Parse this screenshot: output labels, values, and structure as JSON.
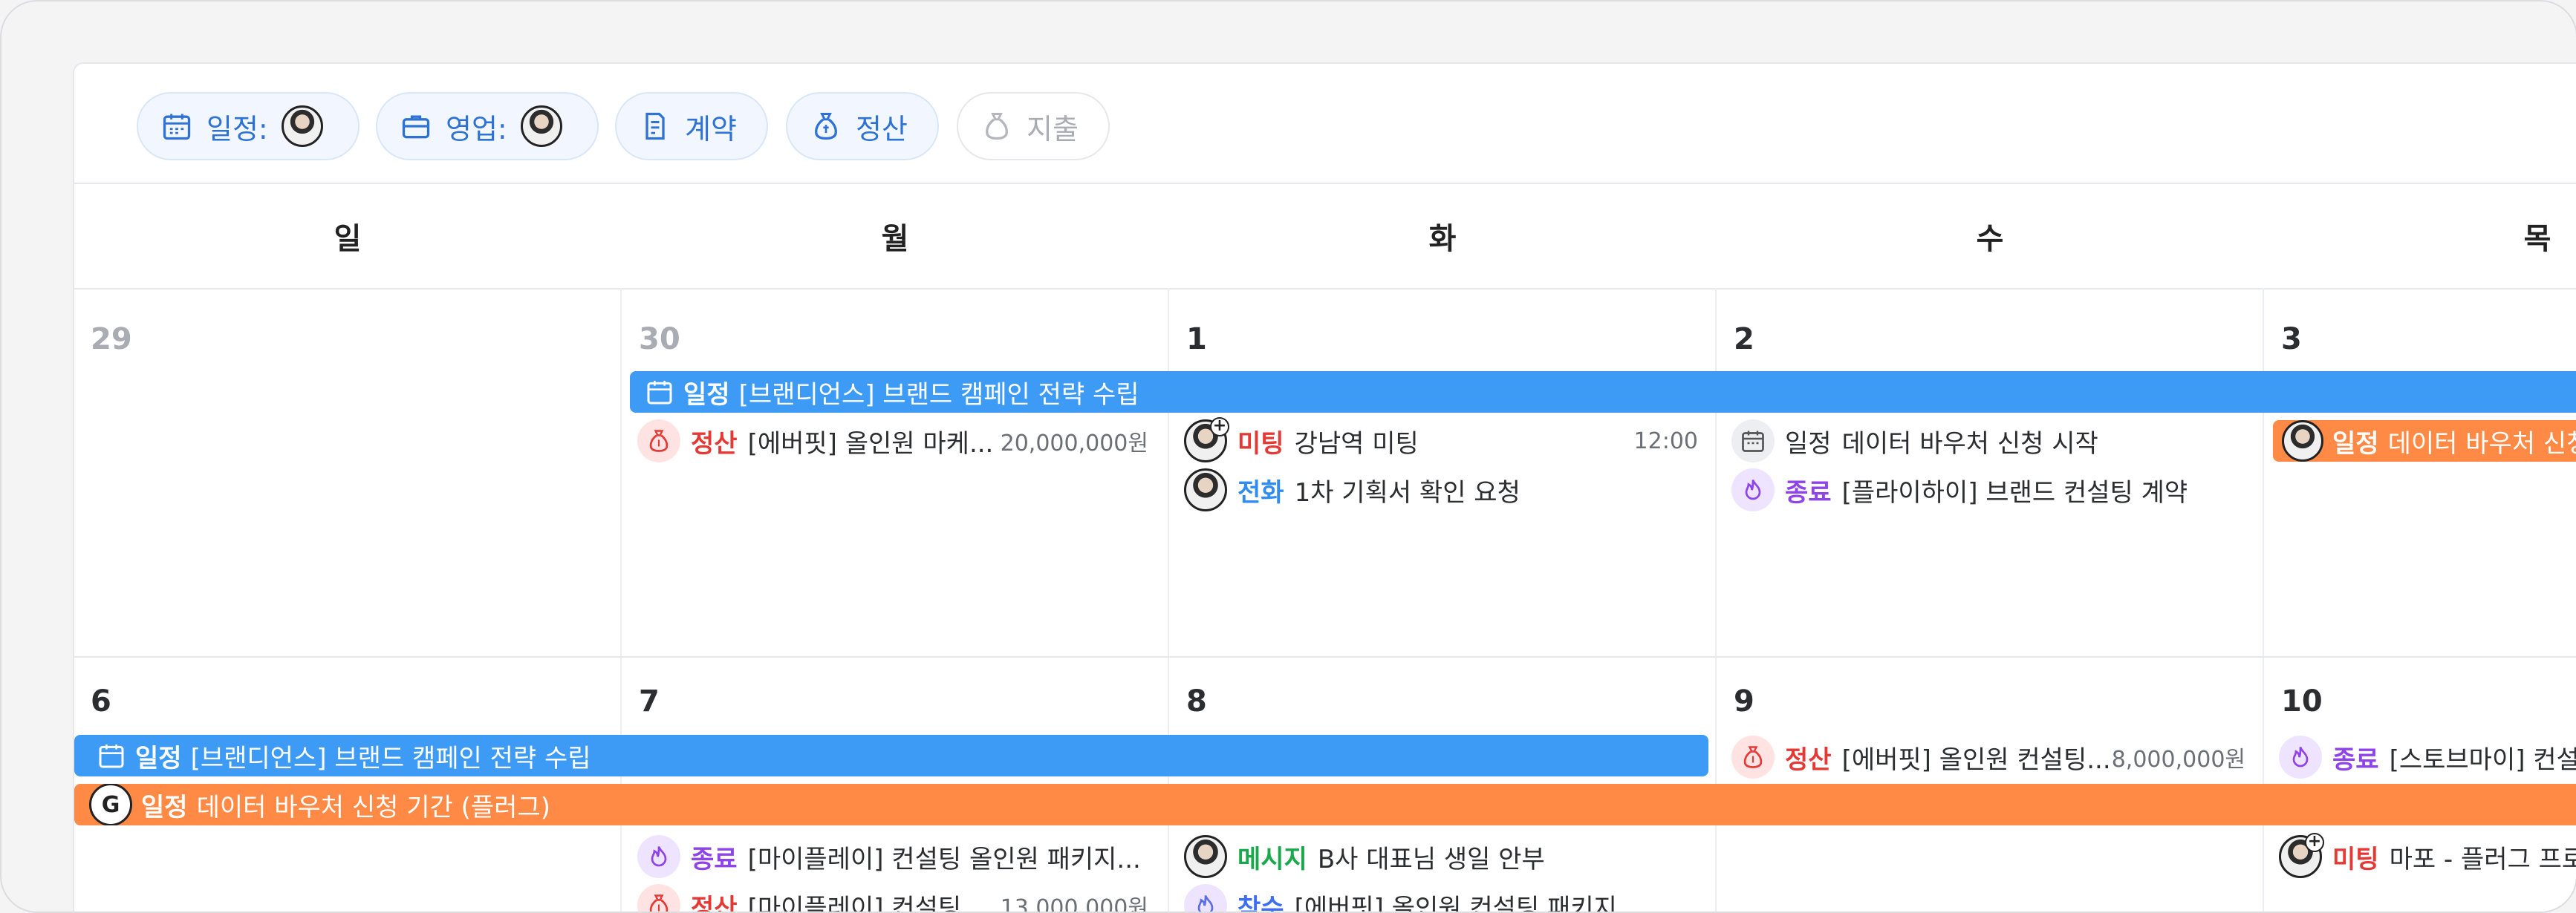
{
  "filters": {
    "schedule_label": "일정:",
    "sales_label": "영업:",
    "contract_label": "계약",
    "settlement_label": "정산",
    "expense_label": "지출"
  },
  "weekdays": [
    "일",
    "월",
    "화",
    "수",
    "목"
  ],
  "week1": {
    "dates": [
      "29",
      "30",
      "1",
      "2",
      "3"
    ],
    "span_bar": {
      "tag": "일정",
      "title": "[브랜디언스] 브랜드 캠페인 전략 수립"
    },
    "mon": [
      {
        "tag": "정산",
        "title": "[에버핏] 올인원 마케...",
        "amount": "20,000,000원"
      }
    ],
    "tue": [
      {
        "tag": "미팅",
        "title": "강남역 미팅",
        "time": "12:00"
      },
      {
        "tag": "전화",
        "title": "1차 기획서 확인 요청"
      }
    ],
    "wed": [
      {
        "tag": "일정",
        "title": "데이터 바우처 신청 시작"
      },
      {
        "tag": "종료",
        "title": "[플라이하이] 브랜드 컨설팅 계약"
      }
    ],
    "thu_bar": {
      "tag": "일정",
      "title": "데이터 바우처 신청"
    }
  },
  "week2": {
    "dates": [
      "6",
      "7",
      "8",
      "9",
      "10"
    ],
    "span_bar": {
      "tag": "일정",
      "title": "[브랜디언스] 브랜드 캠페인 전략 수립"
    },
    "span_bar2": {
      "badge": "G",
      "tag": "일정",
      "title": "데이터 바우처 신청 기간 (플러그)"
    },
    "mon": [
      {
        "tag": "종료",
        "title": "[마이플레이] 컨설팅 올인원 패키지..."
      },
      {
        "tag": "정산",
        "title": "[마이플레이] 컨설팅...",
        "amount": "13,000,000원"
      }
    ],
    "tue": [
      {
        "tag": "메시지",
        "title": "B사 대표님 생일 안부"
      },
      {
        "tag": "착수",
        "title": "[에버핏] 올인원 컨설팅 패키지"
      }
    ],
    "wed": [
      {
        "tag": "정산",
        "title": "[에버핏] 올인원 컨설팅...",
        "amount": "8,000,000원"
      }
    ],
    "thu": [
      {
        "tag": "종료",
        "title": "[스토브마이] 컨설"
      },
      {
        "tag": "미팅",
        "title": "마포 - 플러그 프로"
      }
    ]
  },
  "colors": {
    "blue_bar": "#3d9bf5",
    "orange_bar": "#ff8a45",
    "red_tag": "#e53935",
    "purple_tag": "#8e44e8",
    "blue_tag": "#2f8cf0",
    "green_tag": "#1aa84c"
  }
}
